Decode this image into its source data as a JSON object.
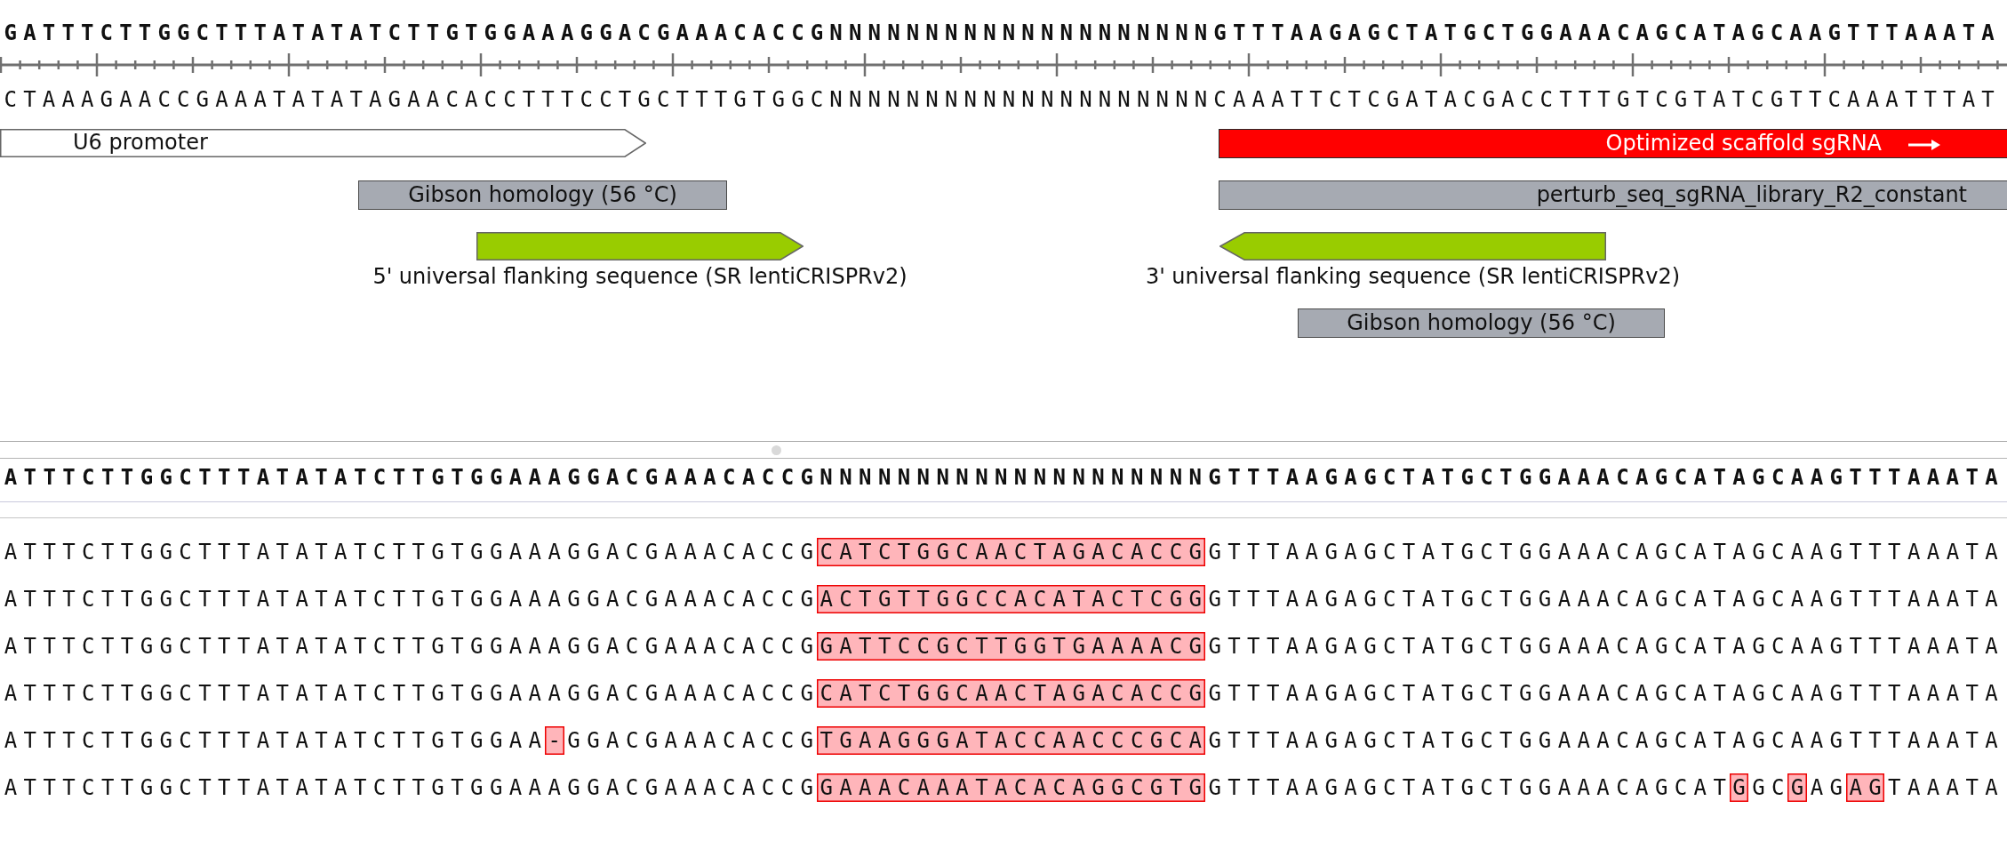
{
  "map": {
    "top_strand": "GATTTCTTGGCTTTATATATCTTGTGGAAAGGACGAAACACCGNNNNNNNNNNNNNNNNNNNNGTTTAAGAGCTATGCTGGAAACAGCATAGCAAGTTTAAATA",
    "bottom_strand": "CTAAAGAACCGAAATATATAGAACACCTTTCCTGCTTTGTGGCNNNNNNNNNNNNNNNNNNNNCAAATTCTCGATACGACCTTTGTCGTATCGTTCAAATTTAT",
    "features": [
      {
        "label": "U6 promoter",
        "kind": "arrow",
        "reverse": false,
        "color": "#ffffff",
        "label_below": false
      },
      {
        "label": "Optimized scaffold sgRNA",
        "kind": "bar",
        "reverse": false,
        "color": "#ff0000",
        "label_below": false
      },
      {
        "label": "Gibson homology (56 °C)",
        "kind": "bar",
        "color": "#a6aab2",
        "label_below": false
      },
      {
        "label": "perturb_seq_sgRNA_library_R2_constant",
        "kind": "bar",
        "color": "#a6aab2",
        "label_below": false
      },
      {
        "label": "5' universal flanking sequence (SR lentiCRISPRv2)",
        "kind": "arrow",
        "reverse": false,
        "color": "#99cc00",
        "label_below": true
      },
      {
        "label": "3' universal flanking sequence (SR lentiCRISPRv2)",
        "kind": "arrow",
        "reverse": true,
        "color": "#99cc00",
        "label_below": true
      },
      {
        "label": "Gibson homology (56 °C)",
        "kind": "bar",
        "color": "#a6aab2",
        "label_below": false
      }
    ]
  },
  "alignment": {
    "reference": "ATTTCTTGGCTTTATATATCTTGTGGAAAGGACGAAACACCGNNNNNNNNNNNNNNNNNNNNGTTTAAGAGCTATGCTGGAAACAGCATAGCAAGTTTAAATA",
    "reads": [
      {
        "segments": [
          {
            "text": "ATTTCTTGGCTTTATATATCTTGTGGAAAGGACGAAACACCG",
            "mismatch": false
          },
          {
            "text": "CATCTGGCAACTAGACACCG",
            "mismatch": true
          },
          {
            "text": "GTTTAAGAGCTATGCTGGAAACAGCATAGCAAGTTTAAATA",
            "mismatch": false
          }
        ]
      },
      {
        "segments": [
          {
            "text": "ATTTCTTGGCTTTATATATCTTGTGGAAAGGACGAAACACCG",
            "mismatch": false
          },
          {
            "text": "ACTGTTGGCCACATACTCGG",
            "mismatch": true
          },
          {
            "text": "GTTTAAGAGCTATGCTGGAAACAGCATAGCAAGTTTAAATA",
            "mismatch": false
          }
        ]
      },
      {
        "segments": [
          {
            "text": "ATTTCTTGGCTTTATATATCTTGTGGAAAGGACGAAACACCG",
            "mismatch": false
          },
          {
            "text": "GATTCCGCTTGGTGAAAACG",
            "mismatch": true
          },
          {
            "text": "GTTTAAGAGCTATGCTGGAAACAGCATAGCAAGTTTAAATA",
            "mismatch": false
          }
        ]
      },
      {
        "segments": [
          {
            "text": "ATTTCTTGGCTTTATATATCTTGTGGAAAGGACGAAACACCG",
            "mismatch": false
          },
          {
            "text": "CATCTGGCAACTAGACACCG",
            "mismatch": true
          },
          {
            "text": "GTTTAAGAGCTATGCTGGAAACAGCATAGCAAGTTTAAATA",
            "mismatch": false
          }
        ]
      },
      {
        "segments": [
          {
            "text": "ATTTCTTGGCTTTATATATCTTGTGGAA",
            "mismatch": false
          },
          {
            "text": "-",
            "mismatch": true
          },
          {
            "text": "GGACGAAACACCG",
            "mismatch": false
          },
          {
            "text": "TGAAGGGATACCAACCCGCA",
            "mismatch": true
          },
          {
            "text": "GTTTAAGAGCTATGCTGGAAACAGCATAGCAAGTTTAAATA",
            "mismatch": false
          }
        ]
      },
      {
        "segments": [
          {
            "text": "ATTTCTTGGCTTTATATATCTTGTGGAAAGGACGAAACACCG",
            "mismatch": false
          },
          {
            "text": "GAAACAAATACACAGGCGTG",
            "mismatch": true
          },
          {
            "text": "GTTTAAGAGCTATGCTGGAAACAGCAT",
            "mismatch": false
          },
          {
            "text": "G",
            "mismatch": true
          },
          {
            "text": "GC",
            "mismatch": false
          },
          {
            "text": "G",
            "mismatch": true
          },
          {
            "text": "AG",
            "mismatch": false
          },
          {
            "text": "AG",
            "mismatch": true
          },
          {
            "text": "TAAATA",
            "mismatch": false
          }
        ]
      }
    ]
  }
}
